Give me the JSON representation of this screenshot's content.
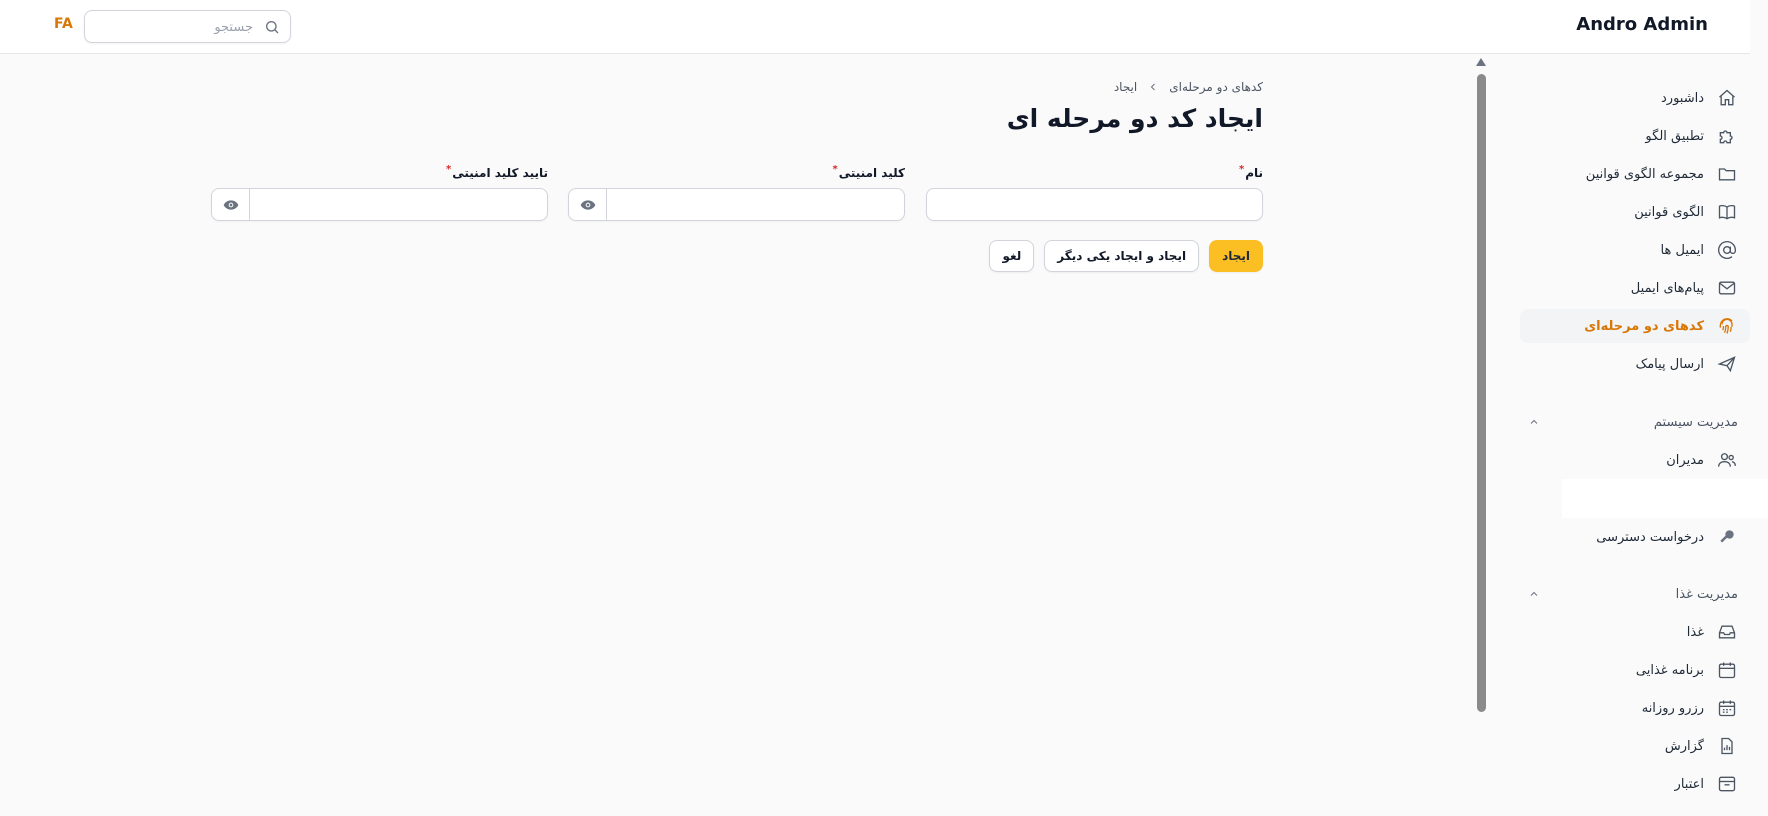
{
  "header": {
    "brand": "Andro Admin",
    "language": "FA",
    "search_placeholder": "جستجو"
  },
  "sidebar": {
    "items": [
      {
        "label": "داشبورد",
        "icon": "home-icon"
      },
      {
        "label": "تطبیق الگو",
        "icon": "puzzle-icon"
      },
      {
        "label": "مجموعه الگوی قوانین",
        "icon": "folder-icon"
      },
      {
        "label": "الگوی قوانین",
        "icon": "book-open-icon"
      },
      {
        "label": "ایمیل ها",
        "icon": "at-sign-icon"
      },
      {
        "label": "پیام‌های ایمیل",
        "icon": "envelope-icon"
      },
      {
        "label": "کدهای دو مرحله‌ای",
        "icon": "fingerprint-icon",
        "active": true
      },
      {
        "label": "ارسال پیامک",
        "icon": "paper-plane-icon"
      }
    ],
    "system_group": {
      "title": "مدیریت سیستم",
      "items": [
        {
          "label": "مدیران",
          "icon": "users-icon"
        },
        {
          "label": "درخواست دسترسی",
          "icon": "key-icon"
        }
      ]
    },
    "food_group": {
      "title": "مدیریت غذا",
      "items": [
        {
          "label": "غذا",
          "icon": "inbox-icon"
        },
        {
          "label": "برنامه غذایی",
          "icon": "calendar-icon"
        },
        {
          "label": "رزرو روزانه",
          "icon": "calendar-days-icon"
        },
        {
          "label": "گزارش",
          "icon": "report-icon"
        },
        {
          "label": "اعتبار",
          "icon": "archive-icon"
        }
      ]
    }
  },
  "breadcrumb": {
    "parent": "کدهای دو مرحله‌ای",
    "current": "ایجاد"
  },
  "page": {
    "title": "ایجاد کد دو مرحله ای"
  },
  "form": {
    "name_label": "نام",
    "secret_label": "کلید امنیتی",
    "confirm_label": "تایید کلید امنیتی",
    "required_mark": "*",
    "name_value": "",
    "secret_value": "",
    "confirm_value": ""
  },
  "actions": {
    "create": "ایجاد",
    "create_another": "ایجاد و ایجاد یکی دیگر",
    "cancel": "لغو"
  },
  "colors": {
    "accent": "#d97706",
    "primary_button": "#fbbf24",
    "required": "#dc2626"
  }
}
